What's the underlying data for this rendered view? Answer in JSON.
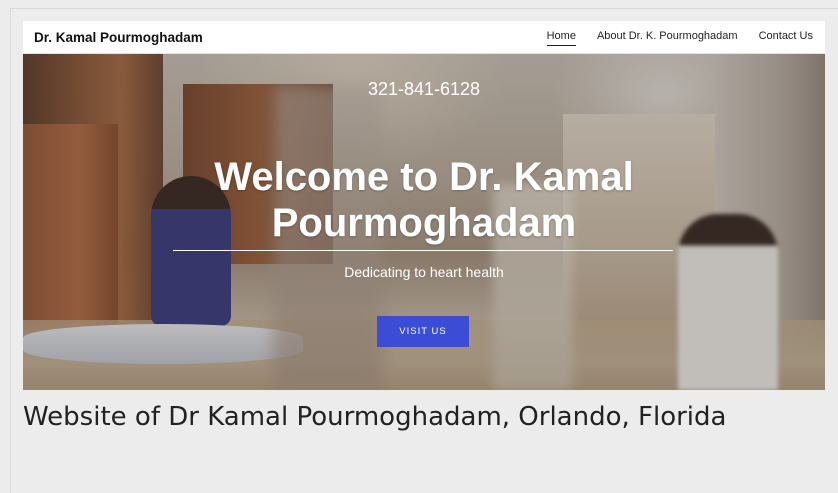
{
  "navbar": {
    "brand": "Dr. Kamal Pourmoghadam",
    "links": [
      {
        "label": "Home",
        "active": true
      },
      {
        "label": "About Dr. K. Pourmoghadam",
        "active": false
      },
      {
        "label": "Contact Us",
        "active": false
      }
    ]
  },
  "hero": {
    "phone": "321-841-6128",
    "headline_line1": "Welcome to Dr. Kamal",
    "headline_line2": "Pourmoghadam",
    "tagline": "Dedicating to heart health",
    "cta_label": "VISIT US",
    "cta_color": "#3a4dd4"
  },
  "caption": "Website of Dr Kamal Pourmoghadam, Orlando, Florida"
}
